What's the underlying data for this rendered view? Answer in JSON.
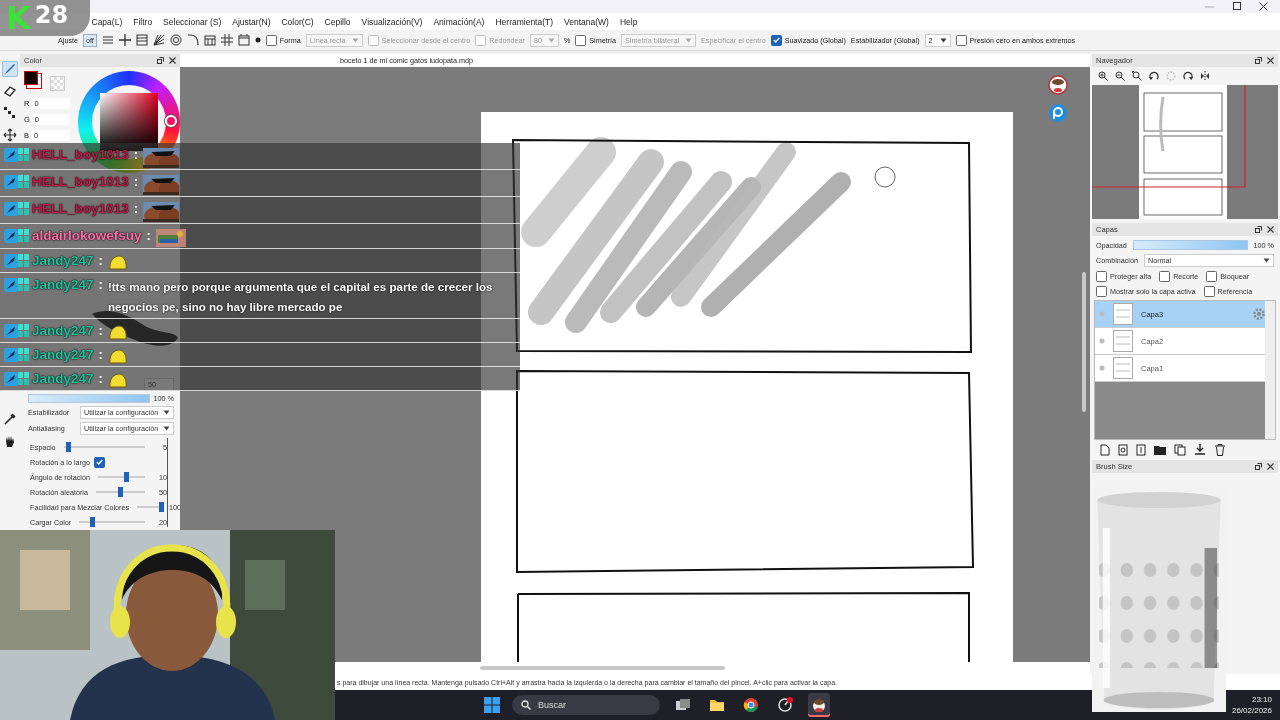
{
  "stream_badge": {
    "logo": "K",
    "viewers": "28"
  },
  "menu": [
    "Capa(L)",
    "Filtro",
    "Seleccionar (S)",
    "Ajustar(N)",
    "Color(C)",
    "Cepillo",
    "Visualización(V)",
    "Animación(A)",
    "Herramienta(T)",
    "Ventana(W)",
    "Help"
  ],
  "toolbar": {
    "snap": {
      "label": "Ajuste",
      "value": "off"
    },
    "controls": [
      {
        "kind": "checkbox",
        "label": "Forma",
        "checked": false,
        "disabled": false
      },
      {
        "kind": "dropdown",
        "value": "Línea recta",
        "disabled": true
      },
      {
        "kind": "checkbox",
        "label": "Seleccionar desde el centro",
        "checked": false,
        "disabled": true
      },
      {
        "kind": "checkbox",
        "label": "Redondear",
        "checked": false,
        "disabled": true
      },
      {
        "kind": "dropdown",
        "value": "80",
        "disabled": true
      },
      {
        "kind": "text",
        "value": "%",
        "disabled": false
      },
      {
        "kind": "checkbox",
        "label": "Simetría",
        "checked": false,
        "disabled": false
      },
      {
        "kind": "dropdown",
        "value": "Simetría bilateral",
        "disabled": true
      },
      {
        "kind": "button",
        "value": "Especificar el centro",
        "disabled": true
      },
      {
        "kind": "checkbox",
        "label": "Suavizado (Global)",
        "checked": true,
        "disabled": false
      },
      {
        "kind": "text",
        "value": "Estabilizador (Global)",
        "disabled": false
      },
      {
        "kind": "dropdown",
        "value": "2",
        "disabled": false
      },
      {
        "kind": "checkbox",
        "label": "Presión cero en ambos extremos",
        "checked": false,
        "disabled": false
      }
    ]
  },
  "tools": [
    {
      "kind": "brush",
      "selected": true
    },
    {
      "kind": "eraser",
      "selected": false
    },
    {
      "kind": "dots",
      "selected": false
    },
    {
      "kind": "move",
      "selected": false
    },
    {
      "kind": "eyedropper",
      "selected": false
    },
    {
      "kind": "hand",
      "selected": false
    }
  ],
  "color_panel": {
    "title": "Color",
    "channels": [
      {
        "label": "R",
        "value": "0"
      },
      {
        "label": "G",
        "value": "0"
      },
      {
        "label": "B",
        "value": "0"
      }
    ]
  },
  "brush_panel": {
    "size": "50",
    "opacity": {
      "level": 1,
      "reading": "100 %"
    },
    "selects": [
      {
        "label": "Estabilizador",
        "value": "Utilizar la configuración"
      },
      {
        "label": "Antialiasing",
        "value": "Utilizar la configuración"
      }
    ],
    "settings": [
      {
        "kind": "slider",
        "label": "Espacio",
        "level": 0.05,
        "reading": "5"
      },
      {
        "kind": "checkbox",
        "label": "Rotación a lo largo",
        "checked": true
      },
      {
        "kind": "slider",
        "label": "Ángulo de rotación",
        "level": 0.6,
        "reading": "10"
      },
      {
        "kind": "slider",
        "label": "Rotación aleatoria",
        "level": 0.5,
        "reading": "50"
      },
      {
        "kind": "slider",
        "label": "Facilidad para Mezclar Colores",
        "level": 1,
        "reading": "100"
      },
      {
        "kind": "slider",
        "label": "Cargar Color",
        "level": 0.2,
        "reading": "20"
      }
    ]
  },
  "document": {
    "title": "boceto 1 de mi comic gatos ludopata.mdp"
  },
  "navigator": {
    "title": "Navegador"
  },
  "layers_panel": {
    "title": "Capas",
    "opacity": {
      "label": "Opacidad",
      "level": 1,
      "reading": "100 %"
    },
    "blend": {
      "label": "Combinación",
      "value": "Normal"
    },
    "options": [
      {
        "label": "Proteger alfa",
        "checked": false
      },
      {
        "label": "Recorte",
        "checked": false
      },
      {
        "label": "Bloquear",
        "checked": false
      },
      {
        "label": "Mostrar solo la capa activa",
        "checked": false
      },
      {
        "label": "Referencia",
        "checked": false
      }
    ],
    "layers": [
      {
        "name": "Capa3",
        "selected": true
      },
      {
        "name": "Capa2",
        "selected": false
      },
      {
        "name": "Capa1",
        "selected": false
      }
    ]
  },
  "brush_size_panel": {
    "title": "Brush Size"
  },
  "chat": [
    {
      "user": "HELL_boy1013",
      "color": "#c4184a",
      "sep": ":"
    },
    {
      "user": "HELL_boy1013",
      "color": "#c4184a",
      "sep": ":"
    },
    {
      "user": "HELL_boy1013",
      "color": "#c4184a",
      "sep": ":"
    },
    {
      "user": "aldairlokowefsuy",
      "color": "#ff6fa8",
      "sep": ":",
      "kind": "sticker"
    },
    {
      "user": "Jandy247",
      "color": "#1fc29e",
      "sep": ":",
      "kind": "blob"
    },
    {
      "user": "Jandy247",
      "color": "#1fc29e",
      "sep": ":",
      "kind": "text",
      "text": "!tts mano pero porque argumenta que el capital es parte de crecer los negocios pe, sino no hay libre mercado pe"
    },
    {
      "user": "Jandy247",
      "color": "#1fc29e",
      "sep": ":",
      "kind": "blob"
    },
    {
      "user": "Jandy247",
      "color": "#1fc29e",
      "sep": ":",
      "kind": "blob"
    },
    {
      "user": "Jandy247",
      "color": "#1fc29e",
      "sep": ":",
      "kind": "blob"
    }
  ],
  "status_bar": "s para dibujar una línea recta. Mantenga pulsado Ctrl+Alt y arrastra hacia la izquierda o la derecha para cambiar el tamaño del pincel. A+clic para activar la capa.",
  "taskbar": {
    "search_placeholder": "Buscar",
    "apps": [
      {
        "kind": "taskview",
        "active": false
      },
      {
        "kind": "folder",
        "active": false
      },
      {
        "kind": "browser",
        "active": false
      },
      {
        "kind": "recorder",
        "active": false
      },
      {
        "kind": "alpaca",
        "active": true
      }
    ],
    "time": "23:10",
    "date": "26/02/2026"
  }
}
